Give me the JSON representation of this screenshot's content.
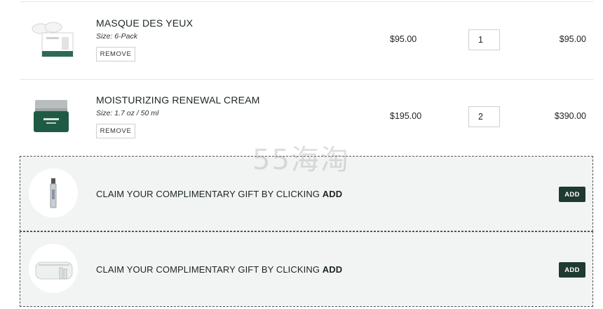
{
  "cart_items": [
    {
      "name": "MASQUE DES YEUX",
      "size": "Size: 6-Pack",
      "remove_label": "REMOVE",
      "price": "$95.00",
      "quantity": "1",
      "total": "$95.00"
    },
    {
      "name": "MOISTURIZING RENEWAL CREAM",
      "size": "Size: 1.7 oz / 50 ml",
      "remove_label": "REMOVE",
      "price": "$195.00",
      "quantity": "2",
      "total": "$390.00"
    }
  ],
  "gifts": [
    {
      "text": "CLAIM YOUR COMPLIMENTARY GIFT BY CLICKING ",
      "text_bold": "ADD",
      "button_label": "ADD"
    },
    {
      "text": "CLAIM YOUR COMPLIMENTARY GIFT BY CLICKING ",
      "text_bold": "ADD",
      "button_label": "ADD"
    }
  ],
  "watermark": "55海淘",
  "colors": {
    "add_button": "#1f3a30",
    "gift_background": "#f2f4f4",
    "jar": "#1f5a45"
  }
}
